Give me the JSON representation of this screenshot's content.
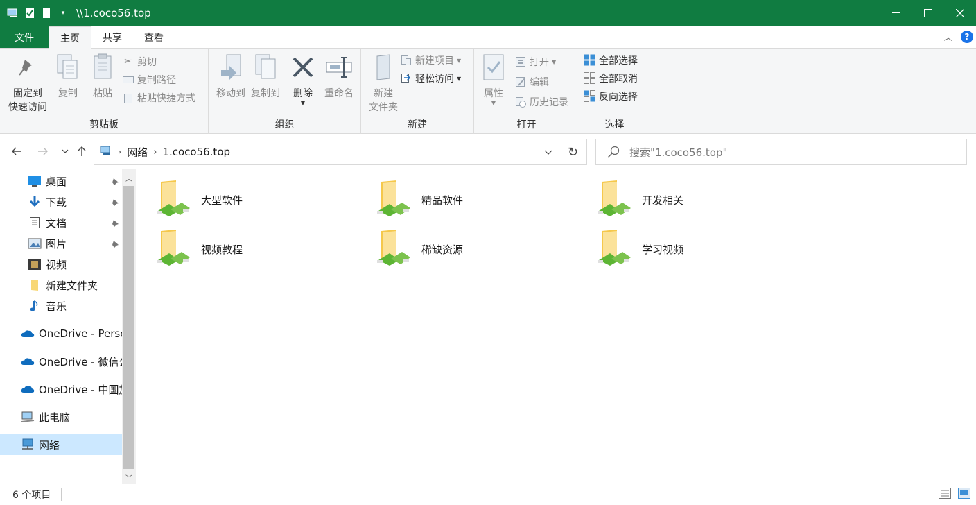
{
  "window": {
    "title": "\\\\1.coco56.top",
    "accent_color": "#107c41"
  },
  "tabs": [
    {
      "label": "文件"
    },
    {
      "label": "主页"
    },
    {
      "label": "共享"
    },
    {
      "label": "查看"
    }
  ],
  "ribbon": {
    "clipboard": {
      "pin": "固定到",
      "pin2": "快速访问",
      "copy": "复制",
      "paste": "粘贴",
      "cut": "剪切",
      "copy_path": "复制路径",
      "paste_shortcut": "粘贴快捷方式",
      "label": "剪贴板"
    },
    "organize": {
      "move_to": "移动到",
      "copy_to": "复制到",
      "delete": "删除",
      "rename": "重命名",
      "label": "组织"
    },
    "new": {
      "new_folder": "新建",
      "new_folder2": "文件夹",
      "new_item": "新建项目",
      "easy_access": "轻松访问",
      "label": "新建"
    },
    "open": {
      "properties": "属性",
      "open": "打开",
      "edit": "编辑",
      "history": "历史记录",
      "label": "打开"
    },
    "select": {
      "select_all": "全部选择",
      "select_none": "全部取消",
      "invert": "反向选择",
      "label": "选择"
    }
  },
  "address": {
    "crumbs": [
      "网络",
      "1.coco56.top"
    ]
  },
  "search": {
    "placeholder": "搜索\"1.coco56.top\""
  },
  "nav": {
    "items": [
      {
        "label": "桌面",
        "icon": "desktop-icon",
        "pinned": true
      },
      {
        "label": "下载",
        "icon": "download-icon",
        "pinned": true
      },
      {
        "label": "文档",
        "icon": "document-icon",
        "pinned": true
      },
      {
        "label": "图片",
        "icon": "picture-icon",
        "pinned": true
      },
      {
        "label": "视频",
        "icon": "video-icon",
        "pinned": false
      },
      {
        "label": "新建文件夹",
        "icon": "folder-icon",
        "pinned": false
      },
      {
        "label": "音乐",
        "icon": "music-icon",
        "pinned": false
      },
      {
        "label": "OneDrive - Personal",
        "icon": "onedrive-icon",
        "pinned": false
      },
      {
        "label": "OneDrive - 微信公众号",
        "icon": "onedrive-icon",
        "pinned": false
      },
      {
        "label": "OneDrive - 中国加",
        "icon": "onedrive-icon",
        "pinned": false
      },
      {
        "label": "此电脑",
        "icon": "computer-icon",
        "pinned": false
      },
      {
        "label": "网络",
        "icon": "network-icon",
        "pinned": false
      }
    ]
  },
  "content": {
    "items": [
      {
        "label": "大型软件"
      },
      {
        "label": "精品软件"
      },
      {
        "label": "开发相关"
      },
      {
        "label": "视频教程"
      },
      {
        "label": "稀缺资源"
      },
      {
        "label": "学习视频"
      }
    ]
  },
  "status": {
    "count": "6 个项目"
  }
}
